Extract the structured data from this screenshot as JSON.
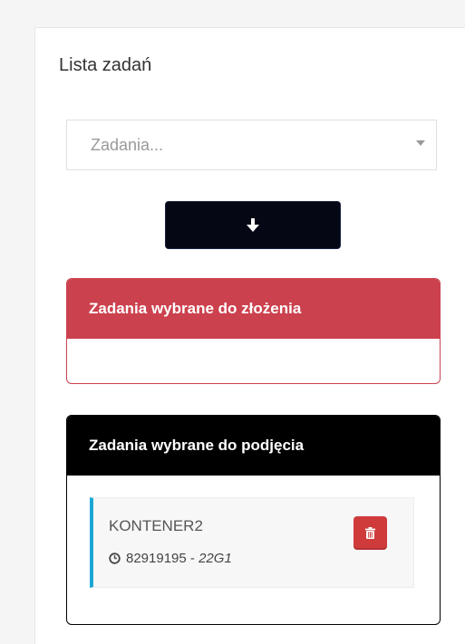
{
  "header": {
    "title": "Lista zadań"
  },
  "task_select": {
    "placeholder": "Zadania..."
  },
  "sections": {
    "to_fold": {
      "title": "Zadania wybrane do złożenia"
    },
    "to_pickup": {
      "title": "Zadania wybrane do podjęcia",
      "items": [
        {
          "name": "KONTENER2",
          "number": "82919195",
          "separator": " - ",
          "code": "22G1"
        }
      ]
    }
  },
  "colors": {
    "danger": "#cc414e",
    "dark": "#000000",
    "accent": "#1da7d6",
    "trash": "#cf3a3a"
  },
  "icons": {
    "move_down": "arrow-down-icon",
    "select_caret": "chevron-down-icon",
    "item_time": "clock-icon",
    "item_delete": "trash-icon"
  }
}
